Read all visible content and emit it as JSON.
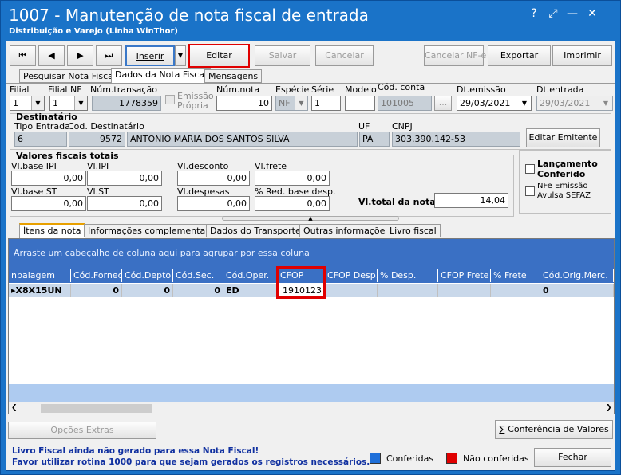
{
  "window": {
    "title": "1007 - Manutenção de nota fiscal de entrada",
    "subtitle": "Distribuição e Varejo (Linha WinThor)",
    "controls": [
      "?",
      "⤢",
      "—",
      "✕"
    ]
  },
  "toolbar": {
    "first": "⏮",
    "prev": "◀",
    "next": "▶",
    "last": "⏭",
    "inserir": "Inserir",
    "dropdown_arrow": "▼",
    "editar": "Editar",
    "salvar": "Salvar",
    "cancelar": "Cancelar",
    "cancelar_nfe": "Cancelar NF-e",
    "exportar": "Exportar",
    "imprimir": "Imprimir"
  },
  "main_tabs": [
    "Pesquisar Nota Fiscal",
    "Dados da Nota Fiscal",
    "Mensagens"
  ],
  "header_fields": {
    "filial_label": "Filial",
    "filial_value": "1",
    "filial_nf_label": "Filial NF",
    "filial_nf_value": "1",
    "num_transacao_label": "Núm.transação",
    "num_transacao_value": "1778359",
    "emissao_propria_label": "Emissão Própria",
    "num_nota_label": "Núm.nota",
    "num_nota_value": "10",
    "especie_label": "Espécie",
    "especie_value": "NF",
    "serie_label": "Série",
    "serie_value": "1",
    "modelo_label": "Modelo",
    "modelo_value": "",
    "cod_conta_label": "Cód. conta",
    "cod_conta_value": "101005",
    "ellipsis": "...",
    "dt_emissao_label": "Dt.emissão",
    "dt_emissao_value": "29/03/2021",
    "dt_entrada_label": "Dt.entrada",
    "dt_entrada_value": "29/03/2021"
  },
  "destinatario": {
    "section": "Destinatário",
    "tipo_entrada_label": "Tipo Entrada",
    "tipo_entrada_value": "6",
    "cod_dest_label": "Cod. Destinatário",
    "cod_dest_value": "9572",
    "nome_value": "ANTONIO  MARIA DOS SANTOS SILVA",
    "uf_label": "UF",
    "uf_value": "PA",
    "cnpj_label": "CNPJ",
    "cnpj_value": "303.390.142-53",
    "editar_emitente": "Editar Emitente"
  },
  "valores": {
    "section": "Valores fiscais totais",
    "vl_base_ipi_label": "Vl.base IPI",
    "vl_base_ipi": "0,00",
    "vl_ipi_label": "Vl.IPI",
    "vl_ipi": "0,00",
    "vl_desconto_label": "Vl.desconto",
    "vl_desconto": "0,00",
    "vl_frete_label": "Vl.frete",
    "vl_frete": "0,00",
    "vl_base_st_label": "Vl.base ST",
    "vl_base_st": "0,00",
    "vl_st_label": "Vl.ST",
    "vl_st": "0,00",
    "vl_despesas_label": "Vl.despesas",
    "vl_despesas": "0,00",
    "red_base_label": "% Red. base desp.",
    "red_base": "0,00",
    "vl_total_label": "Vl.total da nota:",
    "vl_total": "14,04"
  },
  "side_checks": {
    "lancamento": "Lançamento Conferido",
    "nfe_avulsa": "NFe Emissão Avulsa SEFAZ"
  },
  "sub_tabs": [
    "Ítens da nota",
    "Informações complementares",
    "Dados do Transporte",
    "Outras informações",
    "Livro fiscal"
  ],
  "grid": {
    "group_hint": "Arraste um cabeçalho de coluna aqui para agrupar por essa coluna",
    "columns": [
      "nbalagem",
      "Cód.Fornec.",
      "Cód.Depto",
      "Cód.Sec.",
      "Cód.Oper.",
      "CFOP",
      "CFOP Desp.",
      "% Desp.",
      "CFOP Frete",
      "% Frete",
      "Cód.Orig.Merc."
    ],
    "rows": [
      [
        "X8X15UN",
        "0",
        "0",
        "0",
        "ED",
        "1910123",
        "",
        "",
        "",
        "",
        "0"
      ]
    ]
  },
  "footer": {
    "opcoes_extras": "Opções Extras",
    "conferencia": "Conferência de Valores",
    "msg1": "Livro Fiscal ainda não gerado para essa Nota Fiscal!",
    "msg2": "Favor utilizar rotina 1000 para que sejam gerados os registros necessários.",
    "legend_conferidas": "Conferidas",
    "legend_nao": "Não conferidas",
    "fechar": "Fechar",
    "color_conferidas": "#1e6fd9",
    "color_nao": "#e00000"
  }
}
